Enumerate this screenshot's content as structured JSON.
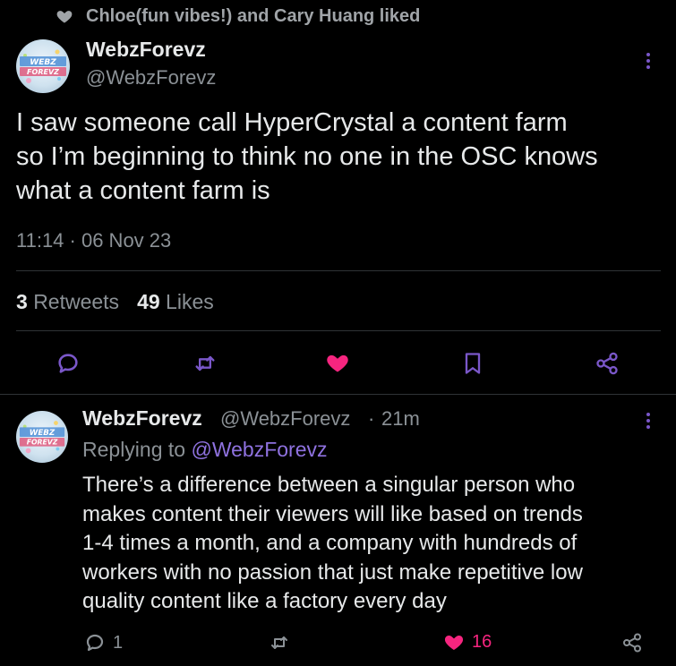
{
  "liked_by": {
    "text": "Chloe(fun vibes!) and Cary Huang liked"
  },
  "main_tweet": {
    "display_name": "WebzForevz",
    "handle": "@WebzForevz",
    "avatar_text": "WEBZ FOREVZ",
    "text": "I saw someone call HyperCrystal a content farm\nso I’m beginning to think no one in the OSC knows\nwhat a content farm is",
    "timestamp": "11:14 · 06 Nov 23",
    "retweets_count": "3",
    "retweets_label": "Retweets",
    "likes_count": "49",
    "likes_label": "Likes",
    "actions": [
      "reply-icon",
      "retweet-icon",
      "heart-filled-icon",
      "bookmark-icon",
      "share-icon"
    ]
  },
  "reply_tweet": {
    "display_name": "WebzForevz",
    "handle": "@WebzForevz",
    "separator": "·",
    "time": "21m",
    "replying_prefix": "Replying to",
    "replying_to": "@WebzForevz",
    "text": "There’s a difference between a singular person who\nmakes content their viewers will like based on trends\n1-4 times a month, and a company with hundreds of\nworkers with no passion that just make repetitive low\nquality content like a factory every day",
    "reply_count": "1",
    "like_count": "16"
  },
  "colors": {
    "background": "#000000",
    "accent_purple": "#7a57c9",
    "like_pink": "#f6257f",
    "muted_text": "#8b9196",
    "divider": "#2f3336"
  }
}
